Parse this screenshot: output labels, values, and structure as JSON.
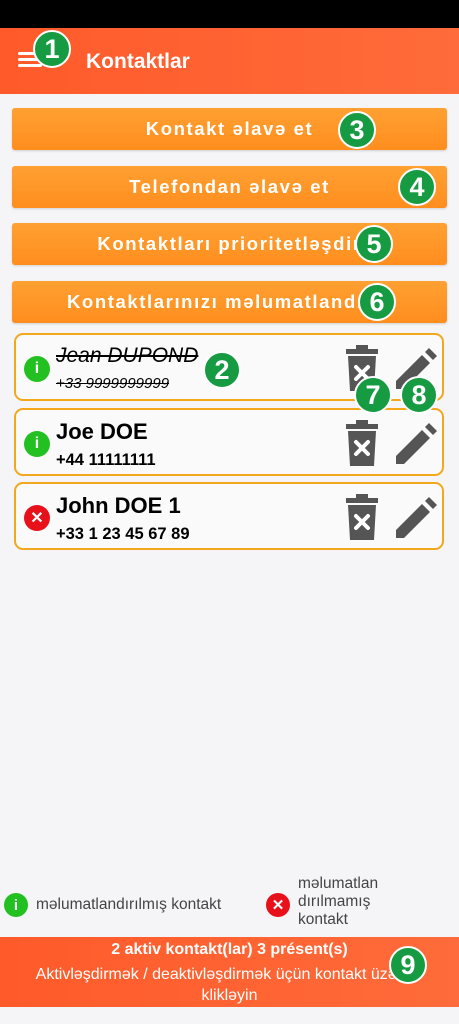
{
  "header": {
    "title": "Kontaktlar"
  },
  "buttons": {
    "add_contact": "Kontakt əlavə et",
    "add_from_phone": "Telefondan əlavə et",
    "prioritize": "Kontaktları prioritetləşdir",
    "notify": "Kontaktlarınızı məlumatlandırın"
  },
  "contacts": [
    {
      "name": "Jean DUPOND",
      "phone": "+33 9999999999",
      "status": "notified",
      "active": false
    },
    {
      "name": "Joe DOE",
      "phone": "+44 11111111",
      "status": "notified",
      "active": true
    },
    {
      "name": "John DOE 1",
      "phone": "+33 1 23 45 67 89",
      "status": "not-notified",
      "active": true
    }
  ],
  "legend": {
    "notified": "məlumatlandırılmış kontakt",
    "not_notified": "məlumatlan dırılmamış kontakt"
  },
  "footer": {
    "status": "2 aktiv kontakt(lar) 3 présent(s)",
    "hint": "Aktivləşdirmək / deaktivləşdirmək üçün kontakt üzərinə klikləyin"
  },
  "markers": [
    "1",
    "2",
    "3",
    "4",
    "5",
    "6",
    "7",
    "8",
    "9"
  ],
  "icons": {
    "menu": "hamburger-menu-icon",
    "delete": "trash-icon",
    "edit": "pencil-icon",
    "notified": "info-icon",
    "not_notified": "close-icon"
  },
  "colors": {
    "header": "#ff5a2a",
    "button": "#ff9a2a",
    "card_border": "#f3a81c",
    "ok": "#22c021",
    "ko": "#e8101a",
    "marker": "#169b43"
  }
}
